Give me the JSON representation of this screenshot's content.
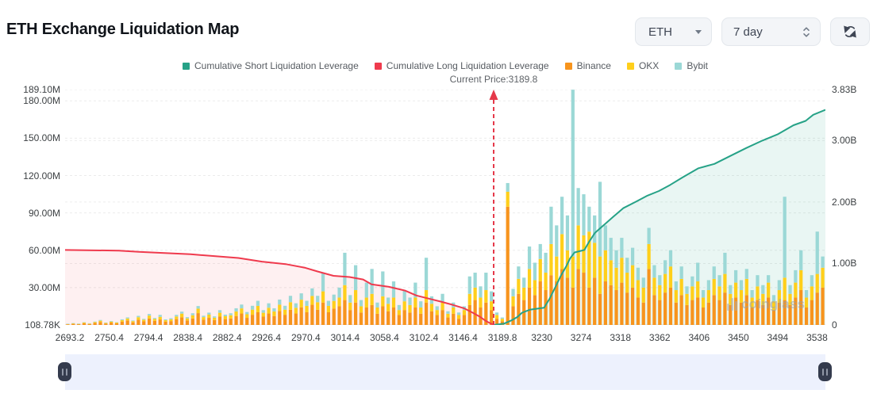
{
  "header": {
    "title": "ETH Exchange Liquidation Map"
  },
  "controls": {
    "symbol_value": "ETH",
    "range_value": "7 day",
    "refresh_icon": "refresh-sync-icon"
  },
  "legend": [
    {
      "label": "Cumulative Short Liquidation Leverage",
      "color": "#26a287"
    },
    {
      "label": "Cumulative Long Liquidation Leverage",
      "color": "#ef3a4d"
    },
    {
      "label": "Binance",
      "color": "#f7941d"
    },
    {
      "label": "OKX",
      "color": "#ffcf1b"
    },
    {
      "label": "Bybit",
      "color": "#9bd8d6"
    }
  ],
  "annotation": {
    "current_price_label": "Current Price:3189.8"
  },
  "watermark": {
    "text": "coinglass"
  },
  "chart_data": {
    "type": "bar",
    "subtype": "stacked-bars-with-cumulative-lines",
    "title": "ETH Exchange Liquidation Map",
    "current_price": 3189.8,
    "current_price_x_frac": 0.5637,
    "x_axis": {
      "tick_labels": [
        "2693.2",
        "2750.4",
        "2794.4",
        "2838.4",
        "2882.4",
        "2926.4",
        "2970.4",
        "3014.4",
        "3058.4",
        "3102.4",
        "3146.4",
        "3189.8",
        "3230",
        "3274",
        "3318",
        "3362",
        "3406",
        "3450",
        "3494",
        "3538"
      ]
    },
    "left_axis": {
      "unit": "M",
      "max_M": 189.1,
      "tick_labels": [
        "189.10M",
        "180.00M",
        "150.00M",
        "120.00M",
        "90.00M",
        "60.00M",
        "30.00M",
        "108.78K"
      ],
      "tick_values_M": [
        189.1,
        180,
        150,
        120,
        90,
        60,
        30,
        0.10878
      ],
      "grid_values_M": [
        189.1,
        180,
        150,
        120,
        90,
        60,
        30
      ]
    },
    "right_axis": {
      "unit": "B",
      "max_B": 3.83,
      "tick_labels": [
        "3.83B",
        "3.00B",
        "2.00B",
        "1.00B",
        "0"
      ],
      "tick_values_B": [
        3.83,
        3,
        2,
        1,
        0
      ],
      "grid_values_B": [
        3,
        2,
        1
      ]
    },
    "series": [
      {
        "name": "Cumulative Short Liquidation Leverage",
        "type": "line",
        "axis": "right",
        "color": "#26a287",
        "fill": "rgba(38,162,135,0.10)",
        "points": [
          [
            0.5637,
            0
          ],
          [
            0.577,
            0.02
          ],
          [
            0.588,
            0.08
          ],
          [
            0.595,
            0.13
          ],
          [
            0.601,
            0.2
          ],
          [
            0.612,
            0.25
          ],
          [
            0.63,
            0.28
          ],
          [
            0.637,
            0.42
          ],
          [
            0.645,
            0.62
          ],
          [
            0.652,
            0.8
          ],
          [
            0.659,
            0.95
          ],
          [
            0.664,
            1.08
          ],
          [
            0.67,
            1.18
          ],
          [
            0.683,
            1.22
          ],
          [
            0.689,
            1.35
          ],
          [
            0.697,
            1.5
          ],
          [
            0.708,
            1.62
          ],
          [
            0.72,
            1.75
          ],
          [
            0.734,
            1.9
          ],
          [
            0.75,
            2.0
          ],
          [
            0.765,
            2.1
          ],
          [
            0.781,
            2.18
          ],
          [
            0.796,
            2.28
          ],
          [
            0.812,
            2.4
          ],
          [
            0.833,
            2.55
          ],
          [
            0.854,
            2.62
          ],
          [
            0.875,
            2.75
          ],
          [
            0.896,
            2.88
          ],
          [
            0.917,
            3.0
          ],
          [
            0.937,
            3.1
          ],
          [
            0.958,
            3.25
          ],
          [
            0.974,
            3.32
          ],
          [
            0.984,
            3.42
          ],
          [
            1.0,
            3.5
          ]
        ]
      },
      {
        "name": "Cumulative Long Liquidation Leverage",
        "type": "line",
        "axis": "right",
        "color": "#ef3a4d",
        "fill": "rgba(239,58,77,0.08)",
        "points": [
          [
            0,
            1.22
          ],
          [
            0.071,
            1.21
          ],
          [
            0.097,
            1.19
          ],
          [
            0.165,
            1.15
          ],
          [
            0.228,
            1.09
          ],
          [
            0.259,
            1.03
          ],
          [
            0.29,
            0.99
          ],
          [
            0.316,
            0.93
          ],
          [
            0.332,
            0.87
          ],
          [
            0.353,
            0.8
          ],
          [
            0.374,
            0.78
          ],
          [
            0.392,
            0.74
          ],
          [
            0.403,
            0.66
          ],
          [
            0.426,
            0.62
          ],
          [
            0.447,
            0.56
          ],
          [
            0.462,
            0.48
          ],
          [
            0.478,
            0.43
          ],
          [
            0.494,
            0.38
          ],
          [
            0.509,
            0.33
          ],
          [
            0.525,
            0.27
          ],
          [
            0.536,
            0.2
          ],
          [
            0.546,
            0.13
          ],
          [
            0.554,
            0.06
          ],
          [
            0.5637,
            0.0
          ]
        ]
      },
      {
        "name": "Binance",
        "type": "bar",
        "axis": "left",
        "color": "#f7941d"
      },
      {
        "name": "OKX",
        "type": "bar",
        "axis": "left",
        "color": "#ffcf1b"
      },
      {
        "name": "Bybit",
        "type": "bar",
        "axis": "left",
        "color": "#9bd8d6"
      }
    ],
    "bars_unit": "M",
    "bars_stack_order": [
      "Binance",
      "OKX",
      "Bybit"
    ],
    "bars": [
      [
        0.5,
        0.3,
        0.2
      ],
      [
        0.9,
        0.4,
        0.2
      ],
      [
        0.6,
        0.3,
        0.2
      ],
      [
        1.3,
        0.6,
        0.3
      ],
      [
        0.8,
        0.4,
        0.2
      ],
      [
        1.6,
        0.7,
        0.4
      ],
      [
        2.4,
        1.0,
        0.6
      ],
      [
        1.1,
        0.5,
        0.3
      ],
      [
        1.9,
        0.8,
        0.5
      ],
      [
        1.3,
        0.6,
        0.3
      ],
      [
        2.6,
        1.2,
        0.7
      ],
      [
        3.6,
        1.6,
        0.9
      ],
      [
        2.1,
        1.0,
        0.5
      ],
      [
        4.2,
        2.0,
        1.1
      ],
      [
        2.9,
        1.3,
        0.7
      ],
      [
        5.2,
        2.3,
        1.3
      ],
      [
        3.3,
        1.5,
        0.8
      ],
      [
        4.4,
        2.1,
        1.6
      ],
      [
        2.6,
        1.2,
        0.7
      ],
      [
        3.1,
        1.4,
        0.9
      ],
      [
        4.7,
        2.1,
        1.3
      ],
      [
        6.2,
        2.9,
        1.6
      ],
      [
        3.6,
        1.7,
        1.0
      ],
      [
        5.2,
        2.6,
        1.6
      ],
      [
        9.5,
        3.6,
        2.1
      ],
      [
        4.2,
        2.1,
        1.1
      ],
      [
        5.7,
        2.6,
        1.6
      ],
      [
        3.9,
        1.9,
        1.1
      ],
      [
        6.7,
        3.1,
        2.1
      ],
      [
        4.7,
        2.3,
        1.3
      ],
      [
        5.2,
        2.6,
        1.6
      ],
      [
        7.2,
        3.6,
        2.6
      ],
      [
        9.2,
        4.1,
        3.1
      ],
      [
        5.7,
        2.9,
        1.8
      ],
      [
        8.2,
        4.1,
        3.1
      ],
      [
        10.2,
        5.1,
        4.1
      ],
      [
        6.7,
        3.1,
        2.1
      ],
      [
        9.2,
        4.6,
        3.6
      ],
      [
        7.2,
        3.6,
        2.6
      ],
      [
        11.2,
        5.1,
        4.1
      ],
      [
        8.2,
        4.1,
        3.1
      ],
      [
        12.2,
        6.1,
        5.1
      ],
      [
        9.2,
        4.6,
        3.6
      ],
      [
        14.2,
        6.1,
        5.1
      ],
      [
        10.2,
        5.1,
        4.1
      ],
      [
        16.2,
        7.1,
        6.1
      ],
      [
        12.2,
        6.1,
        5.1
      ],
      [
        18,
        9,
        15
      ],
      [
        10.2,
        5.1,
        4.1
      ],
      [
        13.2,
        6.1,
        5.1
      ],
      [
        15,
        7,
        8
      ],
      [
        20,
        12,
        26
      ],
      [
        12,
        6,
        6
      ],
      [
        18,
        10,
        20
      ],
      [
        10,
        5,
        5
      ],
      [
        14,
        8,
        12
      ],
      [
        16,
        9,
        20
      ],
      [
        9,
        5,
        4
      ],
      [
        15,
        8,
        20
      ],
      [
        11,
        6,
        5
      ],
      [
        14,
        8,
        13
      ],
      [
        8,
        4,
        4
      ],
      [
        12,
        7,
        9
      ],
      [
        10,
        6,
        6
      ],
      [
        14,
        8,
        12
      ],
      [
        9,
        5,
        5
      ],
      [
        18,
        10,
        26
      ],
      [
        11,
        6,
        6
      ],
      [
        8,
        4,
        3
      ],
      [
        12,
        6,
        7
      ],
      [
        6,
        3,
        2
      ],
      [
        9,
        5,
        4
      ],
      [
        5,
        3,
        2
      ],
      [
        8,
        4,
        3
      ],
      [
        16,
        9,
        14
      ],
      [
        20,
        10,
        12
      ],
      [
        14,
        8,
        9
      ],
      [
        18,
        10,
        14
      ],
      [
        12,
        7,
        8
      ],
      [
        5,
        3,
        2
      ],
      [
        3,
        2,
        1
      ],
      [
        95,
        12,
        7
      ],
      [
        15,
        8,
        6
      ],
      [
        25,
        12,
        10
      ],
      [
        20,
        10,
        8
      ],
      [
        30,
        15,
        18
      ],
      [
        24,
        12,
        14
      ],
      [
        35,
        18,
        12
      ],
      [
        28,
        14,
        16
      ],
      [
        40,
        25,
        30
      ],
      [
        35,
        20,
        25
      ],
      [
        45,
        28,
        30
      ],
      [
        38,
        22,
        28
      ],
      [
        30,
        25,
        134
      ],
      [
        45,
        35,
        30
      ],
      [
        42,
        30,
        33
      ],
      [
        30,
        45,
        20
      ],
      [
        38,
        28,
        22
      ],
      [
        25,
        30,
        60
      ],
      [
        35,
        25,
        20
      ],
      [
        32,
        20,
        18
      ],
      [
        28,
        18,
        14
      ],
      [
        34,
        20,
        16
      ],
      [
        26,
        16,
        12
      ],
      [
        30,
        18,
        14
      ],
      [
        22,
        14,
        10
      ],
      [
        18,
        12,
        8
      ],
      [
        45,
        20,
        13
      ],
      [
        24,
        14,
        10
      ],
      [
        20,
        12,
        8
      ],
      [
        26,
        15,
        11
      ],
      [
        30,
        17,
        13
      ],
      [
        18,
        10,
        7
      ],
      [
        24,
        13,
        10
      ],
      [
        16,
        9,
        6
      ],
      [
        20,
        11,
        8
      ],
      [
        22,
        13,
        15
      ],
      [
        14,
        8,
        6
      ],
      [
        18,
        10,
        8
      ],
      [
        24,
        13,
        10
      ],
      [
        20,
        11,
        9
      ],
      [
        26,
        15,
        17
      ],
      [
        16,
        9,
        7
      ],
      [
        22,
        12,
        10
      ],
      [
        18,
        10,
        8
      ],
      [
        24,
        13,
        8
      ],
      [
        14,
        8,
        6
      ],
      [
        20,
        11,
        9
      ],
      [
        16,
        9,
        7
      ],
      [
        22,
        12,
        6
      ],
      [
        12,
        7,
        5
      ],
      [
        18,
        10,
        8
      ],
      [
        20,
        18,
        65
      ],
      [
        16,
        9,
        7
      ],
      [
        22,
        12,
        10
      ],
      [
        28,
        16,
        16
      ],
      [
        14,
        8,
        6
      ],
      [
        20,
        11,
        9
      ],
      [
        26,
        15,
        34
      ],
      [
        30,
        16,
        9
      ]
    ]
  }
}
